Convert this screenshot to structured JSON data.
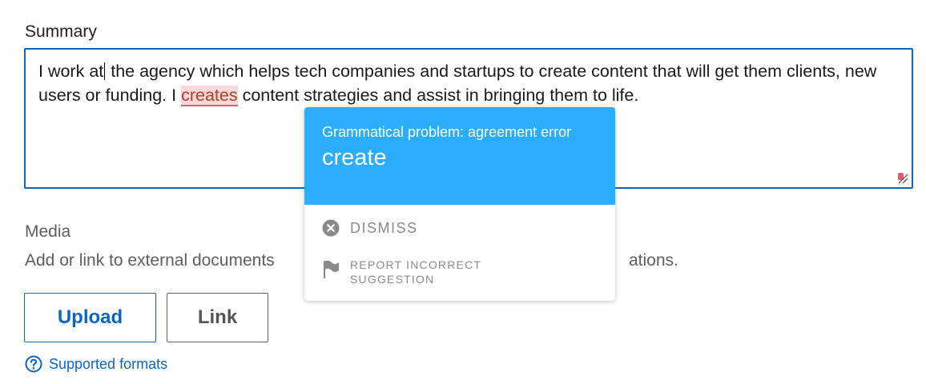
{
  "summary": {
    "label": "Summary",
    "text_before_caret": "I work at",
    "text_after_caret": " the agency which helps tech companies and startups to create content that will get them clients, new users or funding. I ",
    "flagged_word": "creates",
    "text_after_flagged": " content strategies and assist in bringing them to life."
  },
  "grammar_popup": {
    "problem_title": "Grammatical problem: agreement error",
    "suggestion": "create",
    "dismiss_label": "DISMISS",
    "report_label": "REPORT INCORRECT SUGGESTION",
    "accent_color": "#2aaefc",
    "icons": {
      "dismiss": "close-circle-icon",
      "report": "flag-icon"
    }
  },
  "media": {
    "label": "Media",
    "description_start": "Add or link to external documents",
    "description_end": "ations."
  },
  "buttons": {
    "upload_label": "Upload",
    "link_label": "Link"
  },
  "help": {
    "supported_formats_label": "Supported formats",
    "icon": "help-circle-icon"
  },
  "colors": {
    "brand": "#0a66c2",
    "flag_underline": "#e8566c",
    "flag_background": "#f8d7dc"
  }
}
